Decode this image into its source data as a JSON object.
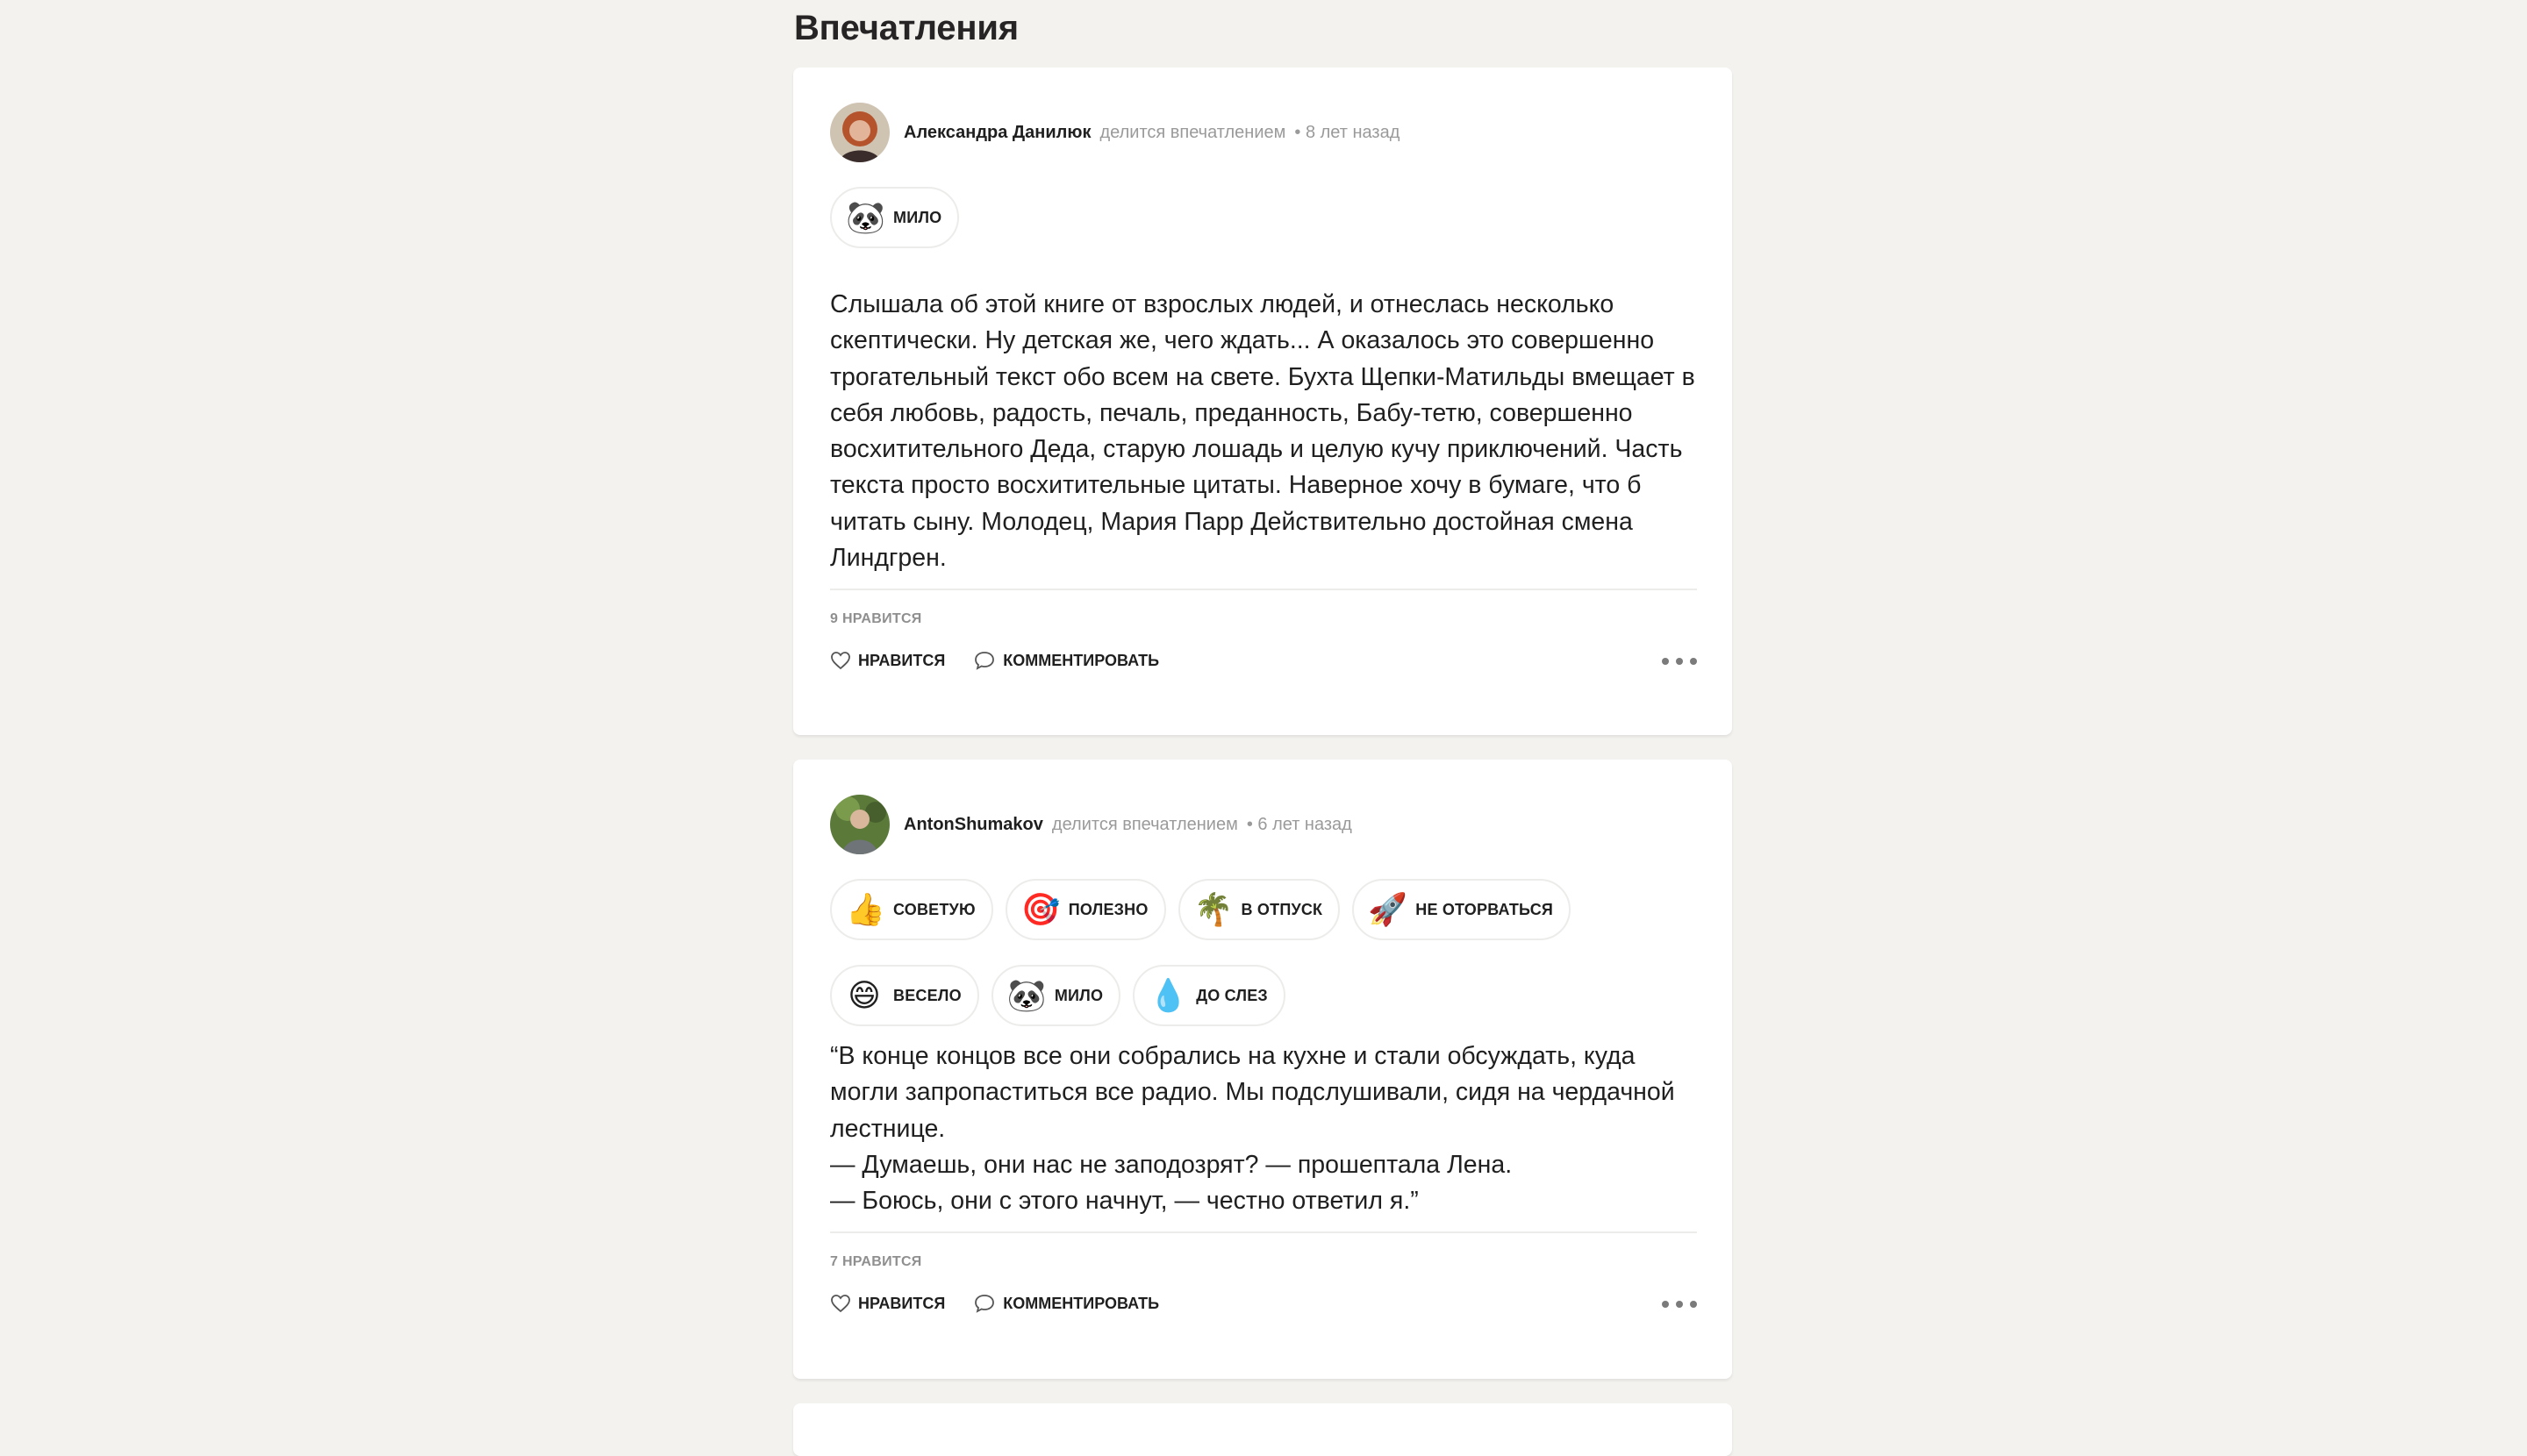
{
  "page": {
    "title": "Впечатления"
  },
  "reviews": [
    {
      "author": "Александра Данилюк",
      "action": "делится впечатлением",
      "time": "• 8 лет назад",
      "chips": [
        {
          "emoji": "🐼",
          "icon": "panda-icon",
          "label": "МИЛО"
        }
      ],
      "text": "Слышала об этой книге от взрослых людей, и отнеслась несколько\nскептически. Ну детская же, чего ждать... А оказалось это совершенно\nтрогательный текст обо всем на свете. Бухта Щепки-Матильды вмещает в\nсебя любовь, радость, печаль, преданность, Бабу-тетю, совершенно\nвосхитительного Деда, старую лошадь и целую кучу приключений. Часть\nтекста просто восхитительные цитаты. Наверное хочу в бумаге, что б\nчитать сыну. Молодец, Мария Парр Действительно достойная смена\nЛиндгрен.",
      "likes": "9 НРАВИТСЯ",
      "like_label": "НРАВИТСЯ",
      "comment_label": "КОММЕНТИРОВАТЬ"
    },
    {
      "author": "AntonShumakov",
      "action": "делится впечатлением",
      "time": "• 6 лет назад",
      "chips": [
        {
          "emoji": "👍",
          "icon": "thumbs-up-icon",
          "label": "СОВЕТУЮ"
        },
        {
          "emoji": "🎯",
          "icon": "target-icon",
          "label": "ПОЛЕЗНО"
        },
        {
          "emoji": "🌴",
          "icon": "palm-tree-icon",
          "label": "В ОТПУСК"
        },
        {
          "emoji": "🚀",
          "icon": "rocket-icon",
          "label": "НЕ ОТОРВАТЬСЯ"
        },
        {
          "emoji": "😄",
          "icon": "smile-icon",
          "label": "ВЕСЕЛО"
        },
        {
          "emoji": "🐼",
          "icon": "panda-icon",
          "label": "МИЛО"
        },
        {
          "emoji": "💧",
          "icon": "droplet-icon",
          "label": "ДО СЛЕЗ"
        }
      ],
      "text": "“В конце концов все они собрались на кухне и стали обсуждать, куда\nмогли запропаститься все радио. Мы подслушивали, сидя на чердачной\nлестнице.\n— Думаешь, они нас не заподозрят? — прошептала Лена.\n— Боюсь, они с этого начнут, — честно ответил я.”",
      "likes": "7 НРАВИТСЯ",
      "like_label": "НРАВИТСЯ",
      "comment_label": "КОММЕНТИРОВАТЬ"
    }
  ],
  "colors": {
    "background": "#f3f2ef",
    "card": "#ffffff",
    "muted": "#9a9a9a",
    "text": "#1f1f1f"
  }
}
